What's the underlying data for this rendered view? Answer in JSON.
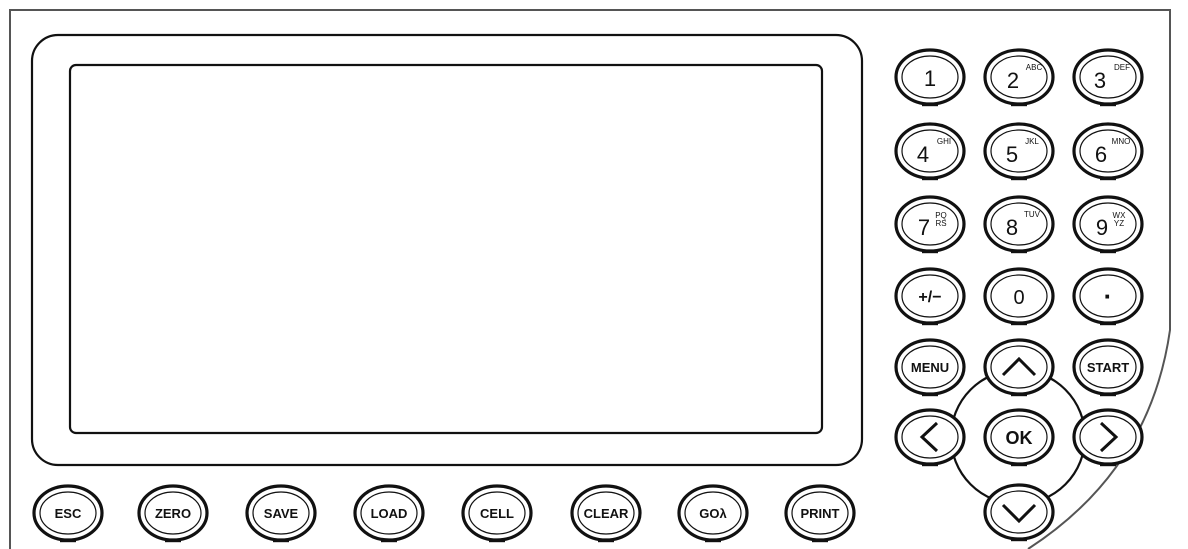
{
  "colors": {
    "outline": "#111111",
    "background": "#ffffff"
  },
  "keypad": {
    "digits": [
      {
        "id": "1",
        "main": "1",
        "sup": ""
      },
      {
        "id": "2",
        "main": "2",
        "sup": "ABC"
      },
      {
        "id": "3",
        "main": "3",
        "sup": "DEF"
      },
      {
        "id": "4",
        "main": "4",
        "sup": "GHI"
      },
      {
        "id": "5",
        "main": "5",
        "sup": "JKL"
      },
      {
        "id": "6",
        "main": "6",
        "sup": "MNO"
      },
      {
        "id": "7",
        "main": "7",
        "sup_top": "PQ",
        "sup_bottom": "RS"
      },
      {
        "id": "8",
        "main": "8",
        "sup": "TUV"
      },
      {
        "id": "9",
        "main": "9",
        "sup_top": "WX",
        "sup_bottom": "YZ"
      }
    ],
    "plus_minus": "+/−",
    "zero": "0",
    "decimal": "·",
    "menu": "MENU",
    "start": "START",
    "ok": "OK"
  },
  "function_keys": [
    "ESC",
    "ZERO",
    "SAVE",
    "LOAD",
    "CELL",
    "CLEAR",
    "GOλ",
    "PRINT"
  ],
  "icons": {
    "up": "chevron-up-icon",
    "down": "chevron-down-icon",
    "left": "chevron-left-icon",
    "right": "chevron-right-icon"
  }
}
